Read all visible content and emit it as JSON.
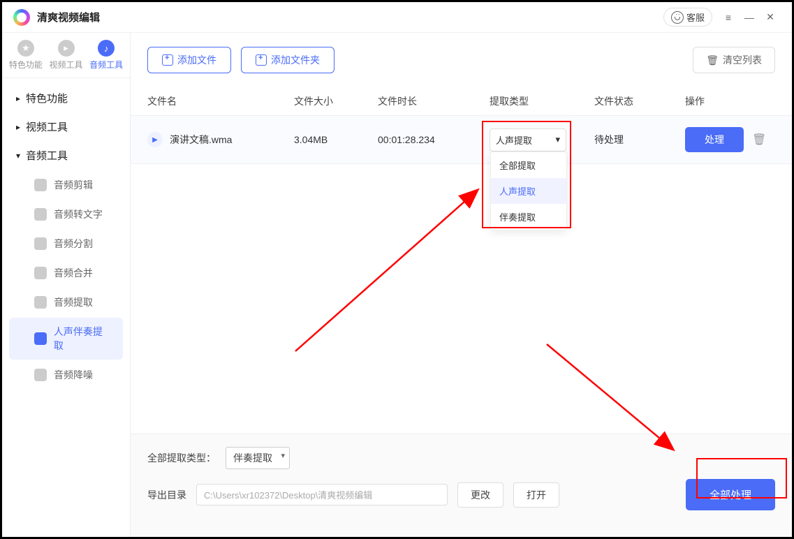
{
  "app": {
    "title": "清爽视频编辑",
    "kefu": "客服"
  },
  "topTabs": [
    {
      "label": "特色功能"
    },
    {
      "label": "视频工具"
    },
    {
      "label": "音频工具"
    }
  ],
  "nav": {
    "groups": [
      {
        "label": "特色功能",
        "expanded": false
      },
      {
        "label": "视频工具",
        "expanded": false
      },
      {
        "label": "音频工具",
        "expanded": true
      }
    ],
    "items": [
      {
        "label": "音频剪辑"
      },
      {
        "label": "音频转文字"
      },
      {
        "label": "音频分割"
      },
      {
        "label": "音频合并"
      },
      {
        "label": "音频提取"
      },
      {
        "label": "人声伴奏提取"
      },
      {
        "label": "音频降噪"
      }
    ]
  },
  "toolbar": {
    "addFile": "添加文件",
    "addFolder": "添加文件夹",
    "clear": "清空列表"
  },
  "columns": {
    "name": "文件名",
    "size": "文件大小",
    "dur": "文件时长",
    "type": "提取类型",
    "status": "文件状态",
    "op": "操作"
  },
  "row": {
    "name": "演讲文稿.wma",
    "size": "3.04MB",
    "dur": "00:01:28.234",
    "typeSelected": "人声提取",
    "status": "待处理",
    "process": "处理"
  },
  "dropdown": {
    "opt0": "全部提取",
    "opt1": "人声提取",
    "opt2": "伴奏提取"
  },
  "footer": {
    "typeLabel": "全部提取类型：",
    "typeValue": "伴奏提取",
    "pathLabel": "导出目录",
    "pathValue": "C:\\Users\\xr102372\\Desktop\\清爽视频编辑",
    "change": "更改",
    "open": "打开",
    "processAll": "全部处理"
  }
}
